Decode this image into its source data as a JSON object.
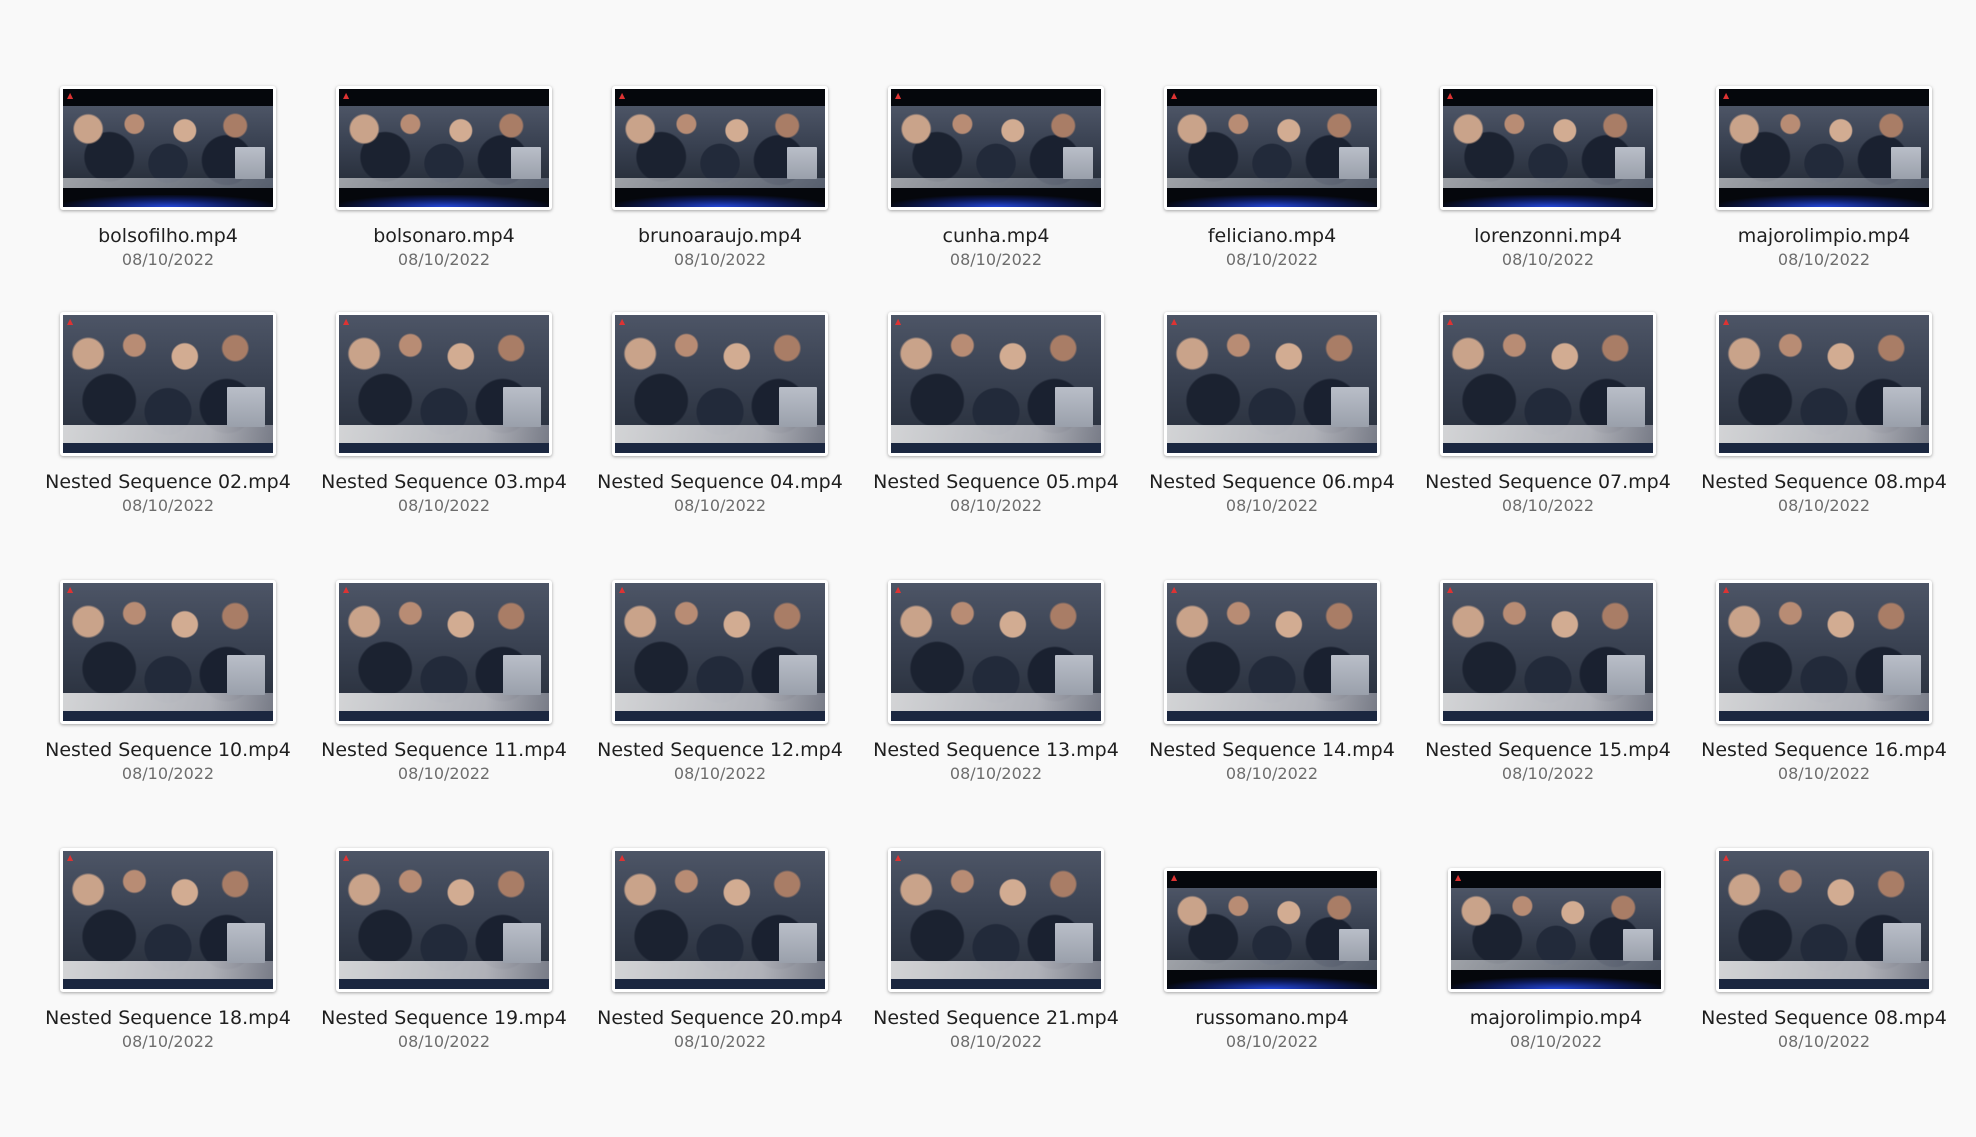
{
  "files": [
    {
      "name": "bolsofilho.mp4",
      "date": "08/10/2022",
      "thumb": "letterbox"
    },
    {
      "name": "bolsonaro.mp4",
      "date": "08/10/2022",
      "thumb": "letterbox"
    },
    {
      "name": "brunoaraujo.mp4",
      "date": "08/10/2022",
      "thumb": "letterbox"
    },
    {
      "name": "cunha.mp4",
      "date": "08/10/2022",
      "thumb": "letterbox"
    },
    {
      "name": "feliciano.mp4",
      "date": "08/10/2022",
      "thumb": "letterbox"
    },
    {
      "name": "lorenzonni.mp4",
      "date": "08/10/2022",
      "thumb": "letterbox"
    },
    {
      "name": "majorolimpio.mp4",
      "date": "08/10/2022",
      "thumb": "letterbox"
    },
    {
      "name": "Nested Sequence 02.mp4",
      "date": "08/10/2022",
      "thumb": "full"
    },
    {
      "name": "Nested Sequence 03.mp4",
      "date": "08/10/2022",
      "thumb": "full"
    },
    {
      "name": "Nested Sequence 04.mp4",
      "date": "08/10/2022",
      "thumb": "full"
    },
    {
      "name": "Nested Sequence 05.mp4",
      "date": "08/10/2022",
      "thumb": "full"
    },
    {
      "name": "Nested Sequence 06.mp4",
      "date": "08/10/2022",
      "thumb": "full"
    },
    {
      "name": "Nested Sequence 07.mp4",
      "date": "08/10/2022",
      "thumb": "full"
    },
    {
      "name": "Nested Sequence 08.mp4",
      "date": "08/10/2022",
      "thumb": "full"
    },
    {
      "name": "Nested Sequence 10.mp4",
      "date": "08/10/2022",
      "thumb": "full"
    },
    {
      "name": "Nested Sequence 11.mp4",
      "date": "08/10/2022",
      "thumb": "full"
    },
    {
      "name": "Nested Sequence 12.mp4",
      "date": "08/10/2022",
      "thumb": "full"
    },
    {
      "name": "Nested Sequence 13.mp4",
      "date": "08/10/2022",
      "thumb": "full"
    },
    {
      "name": "Nested Sequence 14.mp4",
      "date": "08/10/2022",
      "thumb": "full"
    },
    {
      "name": "Nested Sequence 15.mp4",
      "date": "08/10/2022",
      "thumb": "full"
    },
    {
      "name": "Nested Sequence 16.mp4",
      "date": "08/10/2022",
      "thumb": "full"
    },
    {
      "name": "Nested Sequence 18.mp4",
      "date": "08/10/2022",
      "thumb": "full"
    },
    {
      "name": "Nested Sequence 19.mp4",
      "date": "08/10/2022",
      "thumb": "full"
    },
    {
      "name": "Nested Sequence 20.mp4",
      "date": "08/10/2022",
      "thumb": "full"
    },
    {
      "name": "Nested Sequence 21.mp4",
      "date": "08/10/2022",
      "thumb": "full"
    },
    {
      "name": "russomano.mp4",
      "date": "08/10/2022",
      "thumb": "letterbox"
    },
    {
      "name": "majorolimpio.mp4",
      "date": "08/10/2022",
      "thumb": "letterbox"
    },
    {
      "name": "Nested Sequence 08.mp4",
      "date": "08/10/2022",
      "thumb": "full"
    }
  ]
}
